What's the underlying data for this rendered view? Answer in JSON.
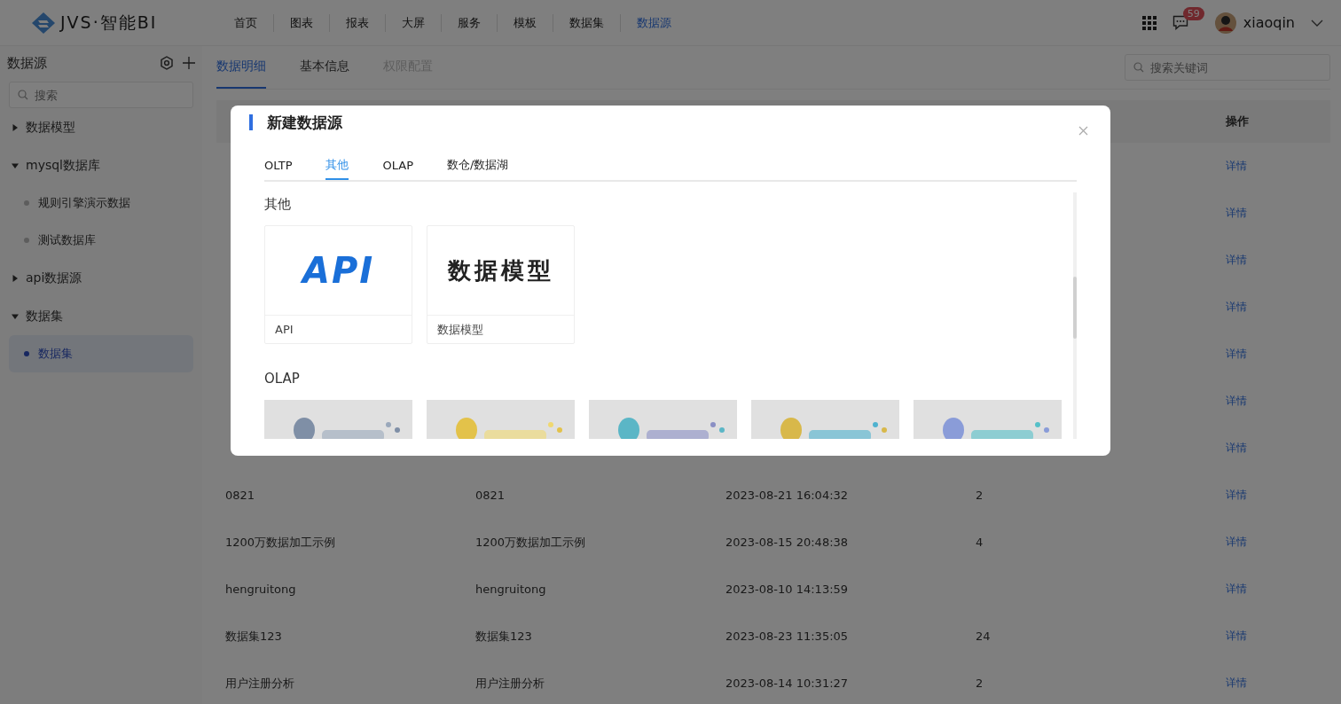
{
  "header": {
    "logo": "JVS·智能BI",
    "nav": [
      {
        "label": "首页",
        "selected": false
      },
      {
        "label": "图表",
        "selected": false
      },
      {
        "label": "报表",
        "selected": false
      },
      {
        "label": "大屏",
        "selected": false
      },
      {
        "label": "服务",
        "selected": false
      },
      {
        "label": "模板",
        "selected": false
      },
      {
        "label": "数据集",
        "selected": false
      },
      {
        "label": "数据源",
        "selected": true
      }
    ],
    "badge": "59",
    "user": "xiaoqin"
  },
  "sidebar": {
    "title": "数据源",
    "search": {
      "placeholder": "搜索"
    },
    "tree": [
      {
        "label": "数据模型",
        "expanded": false
      },
      {
        "label": "mysql数据库",
        "expanded": true,
        "children": [
          {
            "label": "规则引擎演示数据",
            "selected": false
          },
          {
            "label": "测试数据库",
            "selected": false
          }
        ]
      },
      {
        "label": "api数据源",
        "expanded": false
      },
      {
        "label": "数据集",
        "expanded": true,
        "children": [
          {
            "label": "数据集",
            "selected": true
          }
        ]
      }
    ]
  },
  "main": {
    "tabs": [
      {
        "label": "数据明细",
        "selected": true,
        "disabled": false
      },
      {
        "label": "基本信息",
        "selected": false,
        "disabled": false
      },
      {
        "label": "权限配置",
        "selected": false,
        "disabled": true
      }
    ],
    "search": {
      "placeholder": "搜索关键词"
    },
    "table": {
      "action_header": "操作",
      "rows": [
        {
          "action": "详情"
        },
        {
          "action": "详情"
        },
        {
          "action": "详情"
        },
        {
          "action": "详情"
        },
        {
          "action": "详情"
        },
        {
          "action": "详情"
        },
        {
          "action": "详情"
        },
        {
          "cells": [
            "0821",
            "0821",
            "2023-08-21 16:04:32",
            "2"
          ],
          "action": "详情"
        },
        {
          "cells": [
            "1200万数据加工示例",
            "1200万数据加工示例",
            "2023-08-15 20:48:38",
            "4"
          ],
          "action": "详情"
        },
        {
          "cells": [
            "hengruitong",
            "hengruitong",
            "2023-08-10 14:13:59"
          ],
          "action": "详情"
        },
        {
          "cells": [
            "数据集123",
            "数据集123",
            "2023-08-23 11:35:05",
            "24"
          ],
          "action": "详情"
        },
        {
          "cells": [
            "用户注册分析",
            "用户注册分析",
            "2023-08-14 10:31:27",
            "2"
          ],
          "action": "详情"
        }
      ]
    }
  },
  "modal": {
    "title": "新建数据源",
    "tabs": [
      {
        "label": "OLTP",
        "selected": false
      },
      {
        "label": "其他",
        "selected": true
      },
      {
        "label": "OLAP",
        "selected": false
      },
      {
        "label": "数仓/数据湖",
        "selected": false
      }
    ],
    "sections": [
      {
        "heading": "其他",
        "cards": [
          {
            "kind": "api",
            "logo_text": "API",
            "label": "API"
          },
          {
            "kind": "model",
            "logo_text": "数据模型",
            "label": "数据模型"
          }
        ]
      },
      {
        "heading": "OLAP"
      }
    ]
  }
}
